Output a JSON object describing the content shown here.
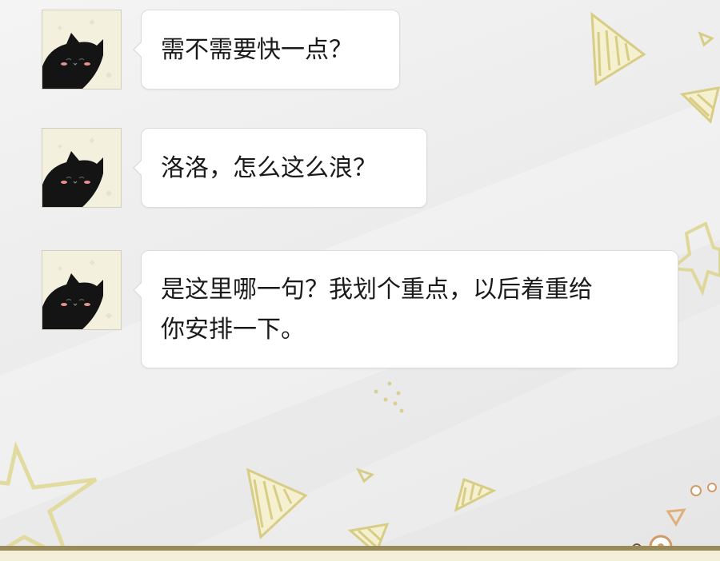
{
  "messages": [
    {
      "avatar": "black-cat-avatar",
      "lines": [
        "需不需要快一点？"
      ]
    },
    {
      "avatar": "black-cat-avatar",
      "lines": [
        "洛洛，怎么这么浪？"
      ]
    },
    {
      "avatar": "black-cat-avatar",
      "lines": [
        "是这里哪一句？我划个重点，以后着重给",
        "你安排一下。"
      ]
    }
  ],
  "colors": {
    "bubble": "#ffffff",
    "background": "#ececec",
    "decoration": "#e2dba0",
    "decoration_stroke": "#c9bd6c"
  }
}
